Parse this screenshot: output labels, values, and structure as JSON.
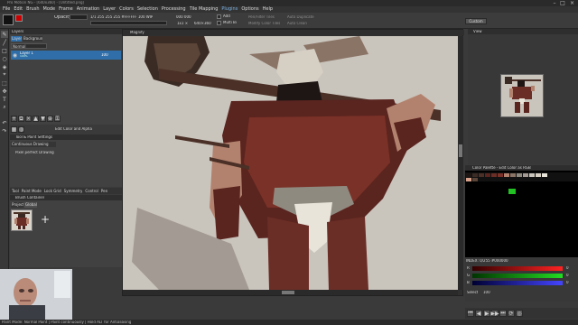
{
  "window": {
    "title": "Pro Motion NG - [640x360] - [Untitled.png]"
  },
  "menubar": {
    "items": [
      "File",
      "Edit",
      "Brush",
      "Mode",
      "Frame",
      "Animation",
      "Layer",
      "Colors",
      "Selection",
      "Processing",
      "Tile Mapping",
      "Plugins",
      "Options",
      "Help"
    ]
  },
  "toolbar": {
    "opacity_label": "Opacity:",
    "frame_info": "1/1 255 255 255 #FFFFFF  100 WIP",
    "coords": "000 000",
    "zoom": "1x1 ×",
    "canvas_size": "640×360",
    "frame_count": "0000/1",
    "checkbox_add": "Add",
    "checkbox_multi": "Multi Bi",
    "pen_label": "Pen/Filter Tiles",
    "modify_label": "Modify Color Tiles",
    "auto_duplicate": "Auto Duplicate",
    "auto_clean": "Auto Clean",
    "custom_btn": "Custom"
  },
  "layers_panel": {
    "title": "Layers",
    "tabs": [
      "Layers",
      "Background"
    ],
    "blend_mode": "Normal",
    "layer_name": "Layer 1",
    "layer_sub": "100%",
    "layer_opacity": "100"
  },
  "tool_settings": {
    "title": "Tool & Paint Settings",
    "tab": "Continuous Drawing",
    "option": "Pixel perfect Drawing",
    "edit_color_label": "Edit Color and Alpha"
  },
  "bottom_tabs": [
    "Tool",
    "Paint Mode",
    "Lock Grid",
    "Symmetry",
    "Control",
    "Pen"
  ],
  "brush_panel": {
    "title": "Brush Container",
    "tabs": [
      "Project",
      "Global"
    ],
    "add_symbol": "+"
  },
  "canvas": {
    "title": "Magnify",
    "bg_color": "#c9c4bc"
  },
  "view_panel": {
    "title": "View"
  },
  "palette_panel": {
    "title": "Color Palette - Edit Color as RGB",
    "index_info": "INDEX: 0/255  #000000",
    "channels": [
      {
        "label": "R",
        "value": "0"
      },
      {
        "label": "G",
        "value": "0"
      },
      {
        "label": "B",
        "value": "0"
      }
    ],
    "select_label": "Select",
    "select_value": "100"
  },
  "statusbar": {
    "text": "Paint Mode: Normal Paint | Paint continuously | Hold ALT for Antialiasing"
  },
  "colors": {
    "accent": "#2f6ea8",
    "panel": "#414141",
    "header": "#2e2e2e",
    "palette_highlight": "#22c022"
  }
}
